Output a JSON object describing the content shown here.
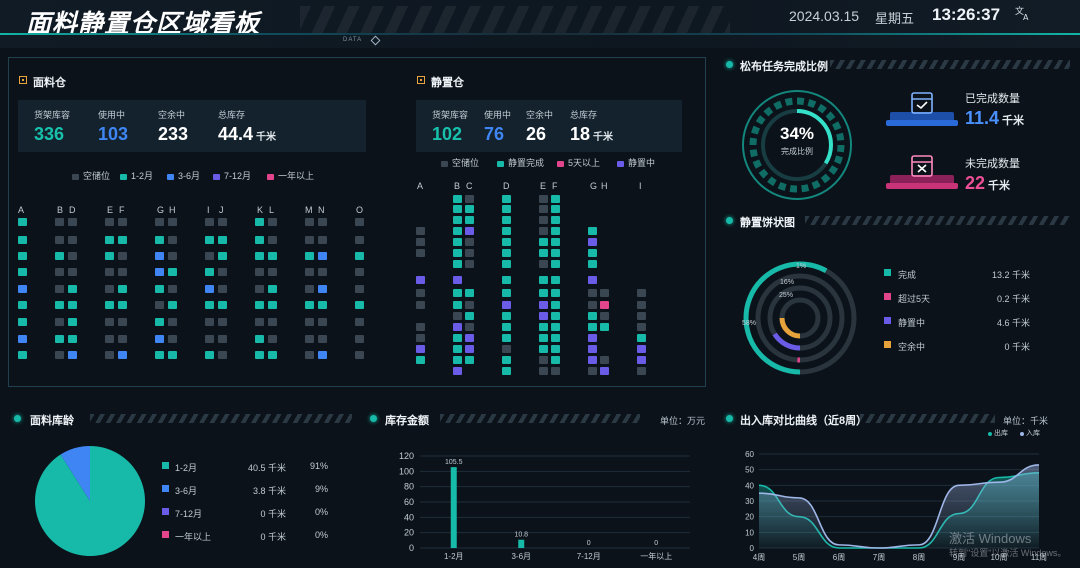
{
  "header": {
    "title": "面料静置仓区域看板",
    "date": "2024.03.15",
    "weekday": "星期五",
    "time": "13:26:37",
    "lang_icon": "translate-icon",
    "tag": "DATA"
  },
  "fabric_warehouse": {
    "title": "面料仓",
    "stats": [
      {
        "label": "货架库容",
        "value": "336",
        "unit": "",
        "color": "#18c1ac"
      },
      {
        "label": "使用中",
        "value": "103",
        "unit": "",
        "color": "#3f86f4"
      },
      {
        "label": "空余中",
        "value": "233",
        "unit": "",
        "color": "#ffffff"
      },
      {
        "label": "总库存",
        "value": "44.4",
        "unit": "千米",
        "color": "#ffffff"
      }
    ],
    "legend": [
      {
        "label": "空储位",
        "color": "#3a4651"
      },
      {
        "label": "1-2月",
        "color": "#17b9a8"
      },
      {
        "label": "3-6月",
        "color": "#3f86f4"
      },
      {
        "label": "7-12月",
        "color": "#6b5ce7"
      },
      {
        "label": "一年以上",
        "color": "#e2458c"
      }
    ],
    "columns": [
      "A",
      "B",
      "D",
      "E",
      "F",
      "G",
      "H",
      "I",
      "J",
      "K",
      "L",
      "M",
      "N",
      "O"
    ]
  },
  "static_warehouse": {
    "title": "静置仓",
    "stats": [
      {
        "label": "货架库容",
        "value": "102",
        "unit": "",
        "color": "#18c1ac"
      },
      {
        "label": "使用中",
        "value": "76",
        "unit": "",
        "color": "#3f86f4"
      },
      {
        "label": "空余中",
        "value": "26",
        "unit": "",
        "color": "#ffffff"
      },
      {
        "label": "总库存",
        "value": "18",
        "unit": "千米",
        "color": "#ffffff"
      }
    ],
    "legend": [
      {
        "label": "空储位",
        "color": "#3a4651"
      },
      {
        "label": "静置完成",
        "color": "#17b9a8"
      },
      {
        "label": "5天以上",
        "color": "#e2458c"
      },
      {
        "label": "静置中",
        "color": "#6b5ce7"
      }
    ],
    "columns": [
      "A",
      "B",
      "C",
      "D",
      "E",
      "F",
      "G",
      "H",
      "I"
    ]
  },
  "task_completion": {
    "title": "松布任务完成比例",
    "percent": "34%",
    "percent_value": 34,
    "sub": "完成比例",
    "done": {
      "label": "已完成数量",
      "value": "11.4",
      "unit": "千米",
      "icon": "calendar-check-icon"
    },
    "undone": {
      "label": "未完成数量",
      "value": "22",
      "unit": "千米",
      "icon": "calendar-cross-icon"
    }
  },
  "static_pie": {
    "title": "静置饼状图",
    "rings": [
      {
        "label": "1%",
        "fraction": 0.01,
        "color": "#e2458c"
      },
      {
        "label": "16%",
        "fraction": 0.16,
        "color": "#6b5ce7"
      },
      {
        "label": "25%",
        "fraction": 0.25,
        "color": "#e6a33c"
      },
      {
        "label": "58%",
        "fraction": 0.58,
        "color": "#17b9a8"
      }
    ],
    "legend": [
      {
        "label": "完成",
        "value": "13.2 千米",
        "color": "#17b9a8"
      },
      {
        "label": "超过5天",
        "value": "0.2 千米",
        "color": "#e2458c"
      },
      {
        "label": "静置中",
        "value": "4.6 千米",
        "color": "#6b5ce7"
      },
      {
        "label": "空余中",
        "value": "0 千米",
        "color": "#e6a33c"
      }
    ]
  },
  "fabric_age": {
    "title": "面料库龄",
    "rows": [
      {
        "label": "1-2月",
        "value": "40.5 千米",
        "pct": "91%",
        "fraction": 0.91,
        "color": "#17b9a8"
      },
      {
        "label": "3-6月",
        "value": "3.8 千米",
        "pct": "9%",
        "fraction": 0.09,
        "color": "#3f86f4"
      },
      {
        "label": "7-12月",
        "value": "0 千米",
        "pct": "0%",
        "fraction": 0,
        "color": "#6b5ce7"
      },
      {
        "label": "一年以上",
        "value": "0 千米",
        "pct": "0%",
        "fraction": 0,
        "color": "#e2458c"
      }
    ]
  },
  "chart_data": [
    {
      "type": "bar",
      "title": "库存金额",
      "unit": "单位：万元",
      "categories": [
        "1-2月",
        "3-6月",
        "7-12月",
        "一年以上"
      ],
      "values": [
        105.5,
        10.8,
        0,
        0
      ],
      "value_labels": [
        "105.5",
        "10.8",
        "0",
        "0"
      ],
      "ylim": [
        0,
        120
      ],
      "yticks": [
        "0",
        "20",
        "40",
        "60",
        "80",
        "100",
        "120"
      ],
      "grid": true
    },
    {
      "type": "area",
      "title": "出入库对比曲线（近8周）",
      "unit": "单位：千米",
      "categories": [
        "4周",
        "5周",
        "6周",
        "7周",
        "8周",
        "9周",
        "10周",
        "11周"
      ],
      "series": [
        {
          "name": "出库",
          "color": "#17b9a8",
          "values": [
            40,
            20,
            0,
            0,
            0,
            22,
            45,
            48
          ]
        },
        {
          "name": "入库",
          "color": "#9fb6e8",
          "values": [
            35,
            32,
            2,
            0,
            2,
            40,
            42,
            53
          ]
        }
      ],
      "ylim": [
        0,
        60
      ],
      "yticks": [
        "0",
        "10",
        "20",
        "30",
        "40",
        "50",
        "60"
      ],
      "legend": "top-right",
      "grid": true
    }
  ],
  "watermark": {
    "line1": "激活 Windows",
    "line2": "转到\"设置\"以激活 Windows。"
  }
}
